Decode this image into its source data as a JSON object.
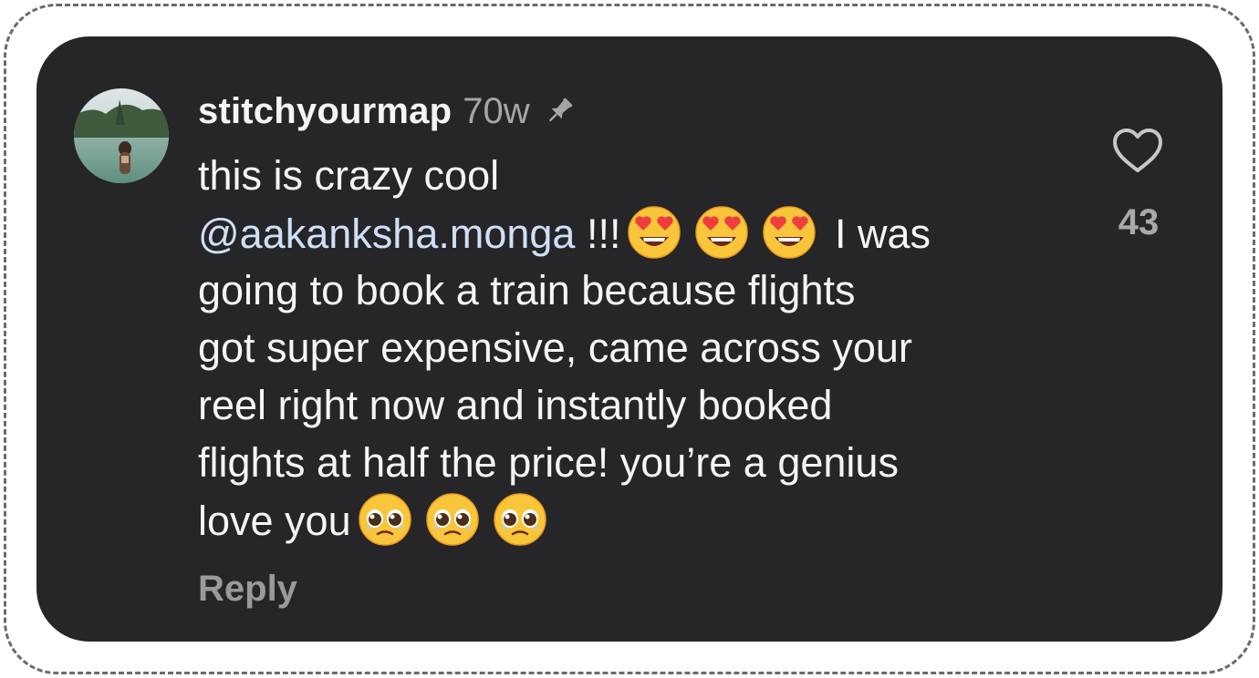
{
  "comment": {
    "username": "stitchyourmap",
    "time": "70w",
    "pinned": true,
    "lines": {
      "l1": "this is crazy cool",
      "l2_mention": "@aakanksha.monga",
      "l2_text": " !!!",
      "l2_after": "I was",
      "l3": "going to book a train because flights",
      "l4": "got super expensive, came across your",
      "l5": "reel right now and instantly booked",
      "l6": "flights at half the price! you’re a genius",
      "l7": "love you"
    },
    "emojis": {
      "line2": [
        "heart-eyes",
        "heart-eyes",
        "heart-eyes"
      ],
      "line7": [
        "pleading-face",
        "pleading-face",
        "pleading-face"
      ]
    },
    "reply_label": "Reply",
    "like_count": "43"
  },
  "colors": {
    "card_background": "#262528",
    "text": "#f5f5f5",
    "muted": "#a6a6a6",
    "mention": "#cfe0f6"
  },
  "icons": [
    "avatar",
    "pin-icon",
    "heart-icon",
    "heart-eyes-emoji",
    "pleading-face-emoji"
  ]
}
